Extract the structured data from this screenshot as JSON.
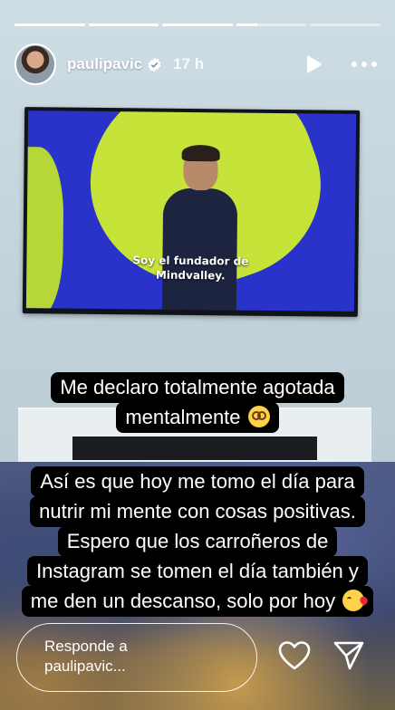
{
  "progress": {
    "segments": [
      1,
      1,
      1,
      0.3,
      0
    ],
    "current_index": 3
  },
  "header": {
    "username": "paulipavic",
    "time_ago": "17 h",
    "verified": true
  },
  "screen": {
    "subtitle": "Soy el fundador de\nMindvalley."
  },
  "captions": {
    "block1": {
      "lines": [
        "Me declaro totalmente agotada",
        "mentalmente"
      ],
      "emoji": "dizzy-face-emoji"
    },
    "block2": {
      "lines": [
        "Así es que hoy me tomo el día para",
        "nutrir mi mente con cosas positivas.",
        "Espero que los carroñeros de",
        "Instagram se tomen el día también y",
        "me den un descanso, solo por hoy"
      ],
      "emoji": "kiss-face-emoji"
    }
  },
  "footer": {
    "reply_placeholder": "Responde a\npaulipavic..."
  },
  "colors": {
    "caption_bg": "#000000",
    "text": "#ffffff",
    "verified": "#ffffff"
  }
}
